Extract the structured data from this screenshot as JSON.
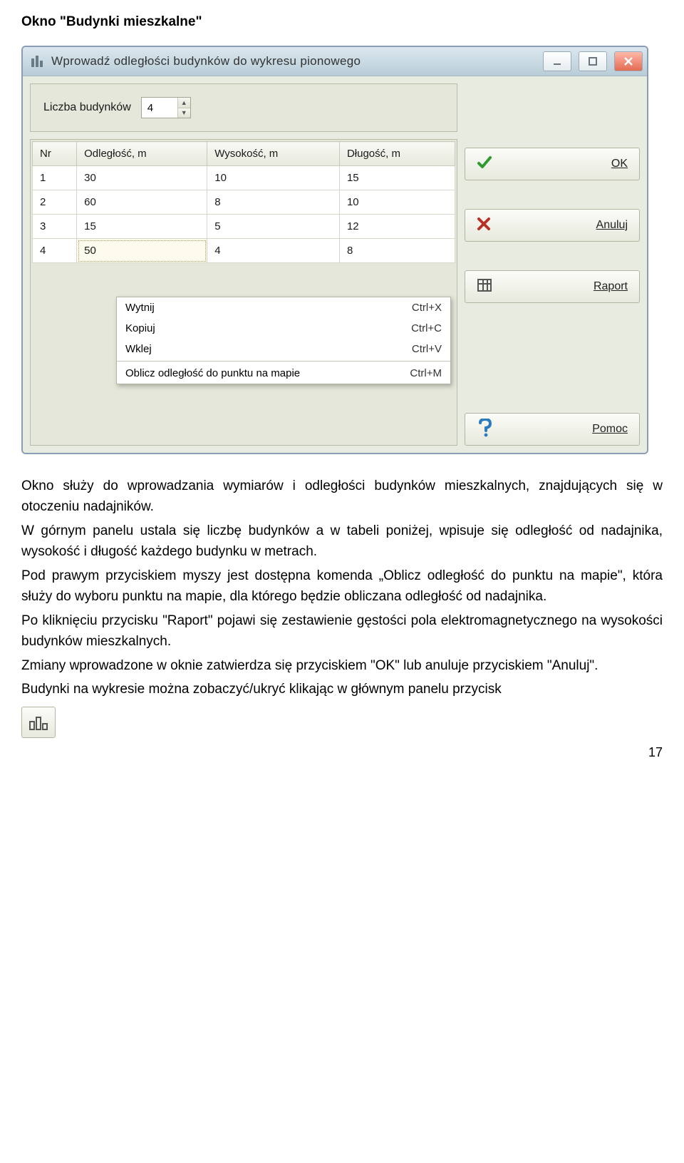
{
  "heading": "Okno \"Budynki mieszkalne\"",
  "window": {
    "title": "Wprowadź odległości budynków do wykresu pionowego",
    "count_label": "Liczba budynków",
    "count_value": "4",
    "columns": [
      "Nr",
      "Odległość, m",
      "Wysokość, m",
      "Długość, m"
    ],
    "rows": [
      {
        "nr": "1",
        "dist": "30",
        "h": "10",
        "len": "15"
      },
      {
        "nr": "2",
        "dist": "60",
        "h": "8",
        "len": "10"
      },
      {
        "nr": "3",
        "dist": "15",
        "h": "5",
        "len": "12"
      },
      {
        "nr": "4",
        "dist": "50",
        "h": "4",
        "len": "8"
      }
    ],
    "buttons": {
      "ok": "OK",
      "cancel": "Anuluj",
      "report": "Raport",
      "help": "Pomoc"
    },
    "context_menu": [
      {
        "label": "Wytnij",
        "shortcut": "Ctrl+X"
      },
      {
        "label": "Kopiuj",
        "shortcut": "Ctrl+C"
      },
      {
        "label": "Wklej",
        "shortcut": "Ctrl+V"
      },
      {
        "sep": true
      },
      {
        "label": "Oblicz odległość do punktu na mapie",
        "shortcut": "Ctrl+M"
      }
    ]
  },
  "paragraphs": [
    "Okno służy do wprowadzania wymiarów i odległości budynków mieszkalnych, znajdujących się w otoczeniu nadajników.",
    "W górnym panelu ustala się liczbę budynków a w tabeli poniżej, wpisuje się odległość od nadajnika, wysokość i długość każdego budynku w metrach.",
    "Pod prawym przyciskiem myszy jest dostępna komenda „Oblicz odległość do punktu na mapie\", która służy do wyboru  punktu na mapie, dla którego będzie obliczana odległość od nadajnika.",
    "Po kliknięciu przycisku \"Raport\" pojawi się zestawienie gęstości pola elektromagnetycznego na wysokości budynków mieszkalnych.",
    "Zmiany wprowadzone w oknie zatwierdza się przyciskiem \"OK\" lub anuluje przyciskiem \"Anuluj\".",
    "Budynki na wykresie można zobaczyć/ukryć klikając w głównym panelu przycisk"
  ],
  "page_number": "17"
}
